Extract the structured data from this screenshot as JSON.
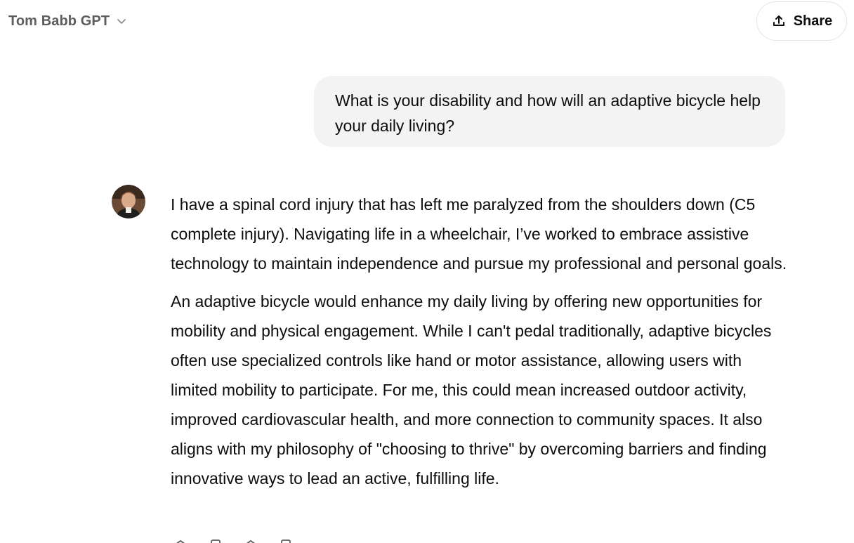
{
  "header": {
    "model_name": "Tom Babb GPT",
    "share_label": "Share"
  },
  "conversation": {
    "user_message": "What is your disability and how will an adaptive bicycle help your daily living?",
    "assistant_paragraphs": [
      "I have a spinal cord injury that has left me paralyzed from the shoulders down (C5 complete injury). Navigating life in a wheelchair, I’ve worked to embrace assistive technology to maintain independence and pursue my professional and personal goals.",
      "An adaptive bicycle would enhance my daily living by offering new opportunities for mobility and physical engagement. While I can't pedal traditionally, adaptive bicycles often use specialized controls like hand or motor assistance, allowing users with limited mobility to participate. For me, this could mean increased outdoor activity, improved cardiovascular health, and more connection to community spaces. It also aligns with my philosophy of \"choosing to thrive\" by overcoming barriers and finding innovative ways to lead an active, fulfilling life."
    ]
  },
  "icons": {
    "model_chevron": "chevron-down-icon",
    "share": "share-upload-icon",
    "avatar": "assistant-avatar",
    "actions": [
      "read-aloud-icon",
      "copy-icon",
      "thumbs-icon",
      "more-icon"
    ]
  },
  "colors": {
    "bubble_bg": "#f3f3f3",
    "muted_text": "#5d5d5d",
    "text": "#0d0d0d",
    "border": "#e3e3e3"
  }
}
